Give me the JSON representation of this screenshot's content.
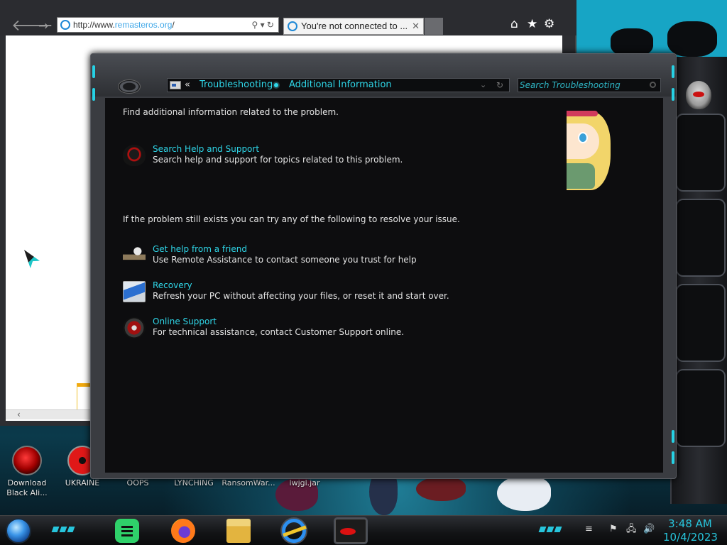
{
  "browser": {
    "address": {
      "prefix": "http://www.",
      "domain": "remasteros.org",
      "suffix": "/"
    },
    "address_buttons": "⚲ ▾ ↻",
    "tab_title": "You're not connected to ...",
    "tab_close": "✕",
    "tools": {
      "home": "⌂",
      "favorites": "★",
      "settings": "⚙"
    },
    "back_glyph": "🡐",
    "forward_glyph": "→"
  },
  "troubleshooting": {
    "breadcrumb": {
      "chevron": "«",
      "items": [
        "Troubleshooting",
        "Additional Information"
      ],
      "dropdown_glyph": "⌄",
      "refresh_glyph": "↻"
    },
    "search_placeholder": "Search Troubleshooting",
    "intro": "Find additional information related to the problem.",
    "help": {
      "title": "Search Help and Support",
      "description": "Search help and support for topics related to this problem."
    },
    "intro2": "If the problem still exists you can try any of the following to resolve your issue.",
    "options": [
      {
        "title": "Get help from a friend",
        "description": "Use Remote Assistance to contact someone you trust for help"
      },
      {
        "title": "Recovery",
        "description": "Refresh your PC without affecting your files, or reset it and start over."
      },
      {
        "title": "Online Support",
        "description": "For technical assistance, contact Customer Support online."
      }
    ]
  },
  "desktop_icons": [
    {
      "label": "Download Black Ali...",
      "icon": "alienware-download-icon"
    },
    {
      "label": "UKRAINE",
      "icon": "nuclear-icon"
    },
    {
      "label": "OOPS",
      "icon": ""
    },
    {
      "label": "LYNCHING",
      "icon": ""
    },
    {
      "label": "RansomWar...",
      "icon": ""
    },
    {
      "label": "lwjgl.jar",
      "icon": ""
    }
  ],
  "taskbar": {
    "apps": [
      "notes-app",
      "firefox",
      "file-explorer",
      "internet-explorer",
      "alienware-app"
    ],
    "tray": {
      "flag": "⚑",
      "network": "🖧",
      "volume": "🔊"
    },
    "time": "3:48 AM",
    "date": "10/4/2023"
  },
  "colors": {
    "accent": "#2fd6e8",
    "window_bg": "#0d0d0f",
    "chrome": "#3a3c41",
    "desktop_teal": "#17a5c5"
  }
}
